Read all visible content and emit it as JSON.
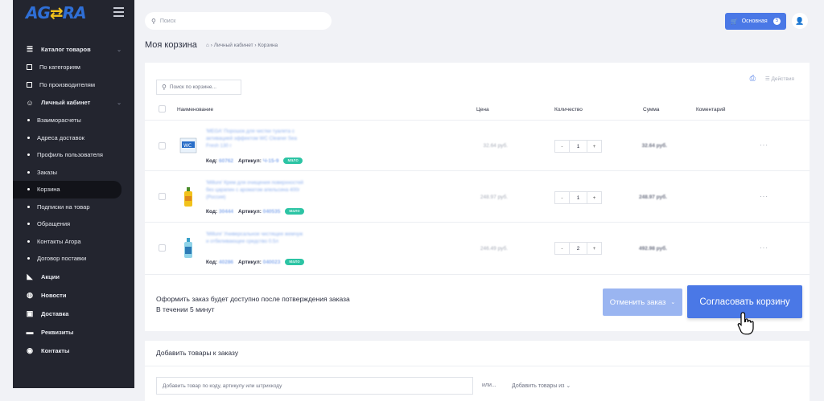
{
  "logo": {
    "a": "AG",
    "arrow": "⇄",
    "b": "RA"
  },
  "sidebar": {
    "catalog": {
      "label": "Каталог товаров",
      "items": [
        "По категориям",
        "По производителям"
      ]
    },
    "cabinet": {
      "label": "Личный кабинет",
      "items": [
        "Взаиморасчеты",
        "Адреса доставок",
        "Профиль пользователя",
        "Заказы",
        "Корзина",
        "Подписки на товар",
        "Обращения",
        "Контакты Агора",
        "Договор поставки"
      ]
    },
    "sections": [
      "Акции",
      "Новости",
      "Доставка",
      "Реквизиты",
      "Контакты"
    ]
  },
  "header": {
    "search_placeholder": "Поиск",
    "main_button": "Основная",
    "main_badge": "5"
  },
  "page": {
    "title": "Моя корзина",
    "breadcrumb": "› Личный кабинет › Корзина"
  },
  "cart": {
    "search_placeholder": "Поиск по корзине...",
    "actions_label": "Действия",
    "columns": {
      "name": "Наименование",
      "price": "Цена",
      "qty": "Количество",
      "sum": "Сумма",
      "comment": "Коментарий"
    },
    "rows": [
      {
        "name": "'MEGA' Порошок для чистки туалета с активацией эффектом WC Cleaner Sea Fresh 130 г",
        "code_label": "Код:",
        "code": "60762",
        "art_label": "Артикул:",
        "art": "Ч-15-9",
        "tag": "мало",
        "price": "32.64 руб.",
        "qty": "1",
        "sum": "32.64 руб."
      },
      {
        "name": "'Millure' Крем для очищения поверхностей без царапин с ароматом апельсина 400г (Россия)",
        "code_label": "Код:",
        "code": "30444",
        "art_label": "Артикул:",
        "art": "040535",
        "tag": "мало",
        "price": "248.97 руб.",
        "qty": "1",
        "sum": "248.97 руб."
      },
      {
        "name": "'Millure' Универсальное чистящее жемчуж и отбеливающее средство 0.5л",
        "code_label": "Код:",
        "code": "40286",
        "art_label": "Артикул:",
        "art": "040023",
        "tag": "мало",
        "price": "246.49 руб.",
        "qty": "2",
        "sum": "492.98 руб."
      }
    ],
    "qty_minus": "-",
    "qty_plus": "+",
    "more": "···",
    "footer_line1": "Оформить заказ будет доступно после потверждения заказа",
    "footer_line2": "В течении 5 минут",
    "cancel_button": "Отменить заказ",
    "agree_button": "Согласовать корзину"
  },
  "add_goods": {
    "title": "Добавить товары к заказу",
    "input_placeholder": "Добавить товар по коду, артикулу или штрихкоду",
    "or": "или...",
    "add_from": "Добавить товары из"
  },
  "colors": {
    "accent": "#4a78e6",
    "accent_light": "#9ab5f1",
    "sidebar_bg": "#23252f",
    "tag": "#2cc4a4"
  }
}
